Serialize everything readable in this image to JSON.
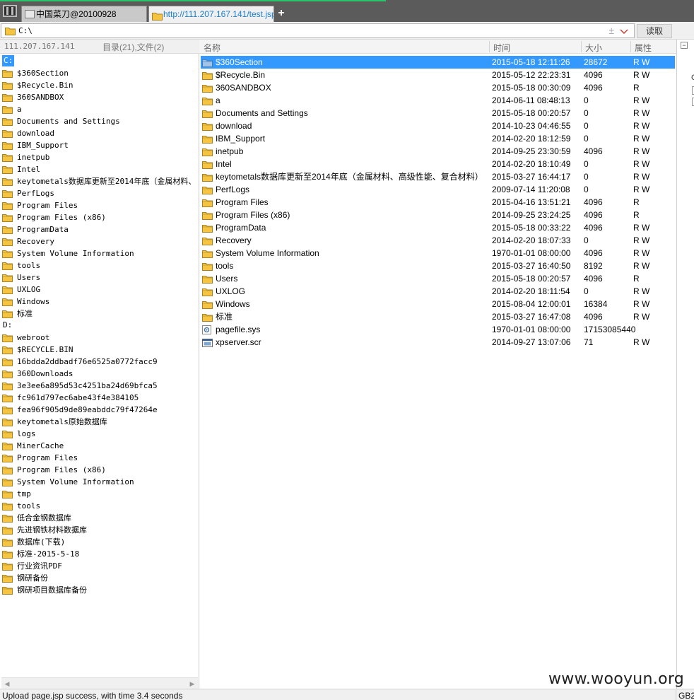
{
  "tabs": [
    {
      "label": "中国菜刀@20100928",
      "active": false
    },
    {
      "label": "http://111.207.167.141/test.jsp",
      "active": true
    }
  ],
  "address": {
    "value": "C:\\",
    "read_button": "读取",
    "plus": "±"
  },
  "left_header": {
    "host": "111.207.167.141",
    "counts": "目录(21),文件(2)"
  },
  "columns": {
    "name": "名称",
    "time": "时间",
    "size": "大小",
    "attr": "属性"
  },
  "tree_c": {
    "drive": "C:",
    "items": [
      "$360Section",
      "$Recycle.Bin",
      "360SANDBOX",
      "a",
      "Documents and Settings",
      "download",
      "IBM_Support",
      "inetpub",
      "Intel",
      "keytometals数据库更新至2014年底（金属材料、",
      "PerfLogs",
      "Program Files",
      "Program Files (x86)",
      "ProgramData",
      "Recovery",
      "System Volume Information",
      "tools",
      "Users",
      "UXLOG",
      "Windows",
      "标准"
    ]
  },
  "tree_d": {
    "drive": "D:",
    "items": [
      "webroot",
      "$RECYCLE.BIN",
      "16bdda2ddbadf76e6525a0772facc9",
      "360Downloads",
      "3e3ee6a895d53c4251ba24d69bfca5",
      "fc961d797ec6abe43f4e384105",
      "fea96f905d9de89eabddc79f47264e",
      "keytometals原始数据库",
      "logs",
      "MinerCache",
      "Program Files",
      "Program Files (x86)",
      "System Volume Information",
      "tmp",
      "tools",
      "低合金钢数据库",
      "先进钢铁材料数据库",
      "数据库(下载)",
      "标准-2015-5-18",
      "行业资讯PDF",
      "钢研备份",
      "钢研项目数据库备份"
    ]
  },
  "files": [
    {
      "name": "$360Section",
      "time": "2015-05-18 12:11:26",
      "size": "28672",
      "attr": "R W",
      "type": "folder-open",
      "selected": true
    },
    {
      "name": "$Recycle.Bin",
      "time": "2015-05-12 22:23:31",
      "size": "4096",
      "attr": "R W",
      "type": "folder"
    },
    {
      "name": "360SANDBOX",
      "time": "2015-05-18 00:30:09",
      "size": "4096",
      "attr": "R",
      "type": "folder"
    },
    {
      "name": "a",
      "time": "2014-06-11 08:48:13",
      "size": "0",
      "attr": "R W",
      "type": "folder"
    },
    {
      "name": "Documents and Settings",
      "time": "2015-05-18 00:20:57",
      "size": "0",
      "attr": "R W",
      "type": "folder"
    },
    {
      "name": "download",
      "time": "2014-10-23 04:46:55",
      "size": "0",
      "attr": "R W",
      "type": "folder"
    },
    {
      "name": "IBM_Support",
      "time": "2014-02-20 18:12:59",
      "size": "0",
      "attr": "R W",
      "type": "folder"
    },
    {
      "name": "inetpub",
      "time": "2014-09-25 23:30:59",
      "size": "4096",
      "attr": "R W",
      "type": "folder"
    },
    {
      "name": "Intel",
      "time": "2014-02-20 18:10:49",
      "size": "0",
      "attr": "R W",
      "type": "folder"
    },
    {
      "name": "keytometals数据库更新至2014年底（金属材料、高级性能、复合材料）",
      "time": "2015-03-27 16:44:17",
      "size": "0",
      "attr": "R W",
      "type": "folder"
    },
    {
      "name": "PerfLogs",
      "time": "2009-07-14 11:20:08",
      "size": "0",
      "attr": "R W",
      "type": "folder"
    },
    {
      "name": "Program Files",
      "time": "2015-04-16 13:51:21",
      "size": "4096",
      "attr": "R",
      "type": "folder"
    },
    {
      "name": "Program Files (x86)",
      "time": "2014-09-25 23:24:25",
      "size": "4096",
      "attr": "R",
      "type": "folder"
    },
    {
      "name": "ProgramData",
      "time": "2015-05-18 00:33:22",
      "size": "4096",
      "attr": "R W",
      "type": "folder"
    },
    {
      "name": "Recovery",
      "time": "2014-02-20 18:07:33",
      "size": "0",
      "attr": "R W",
      "type": "folder"
    },
    {
      "name": "System Volume Information",
      "time": "1970-01-01 08:00:00",
      "size": "4096",
      "attr": "R W",
      "type": "folder"
    },
    {
      "name": "tools",
      "time": "2015-03-27 16:40:50",
      "size": "8192",
      "attr": "R W",
      "type": "folder"
    },
    {
      "name": "Users",
      "time": "2015-05-18 00:20:57",
      "size": "4096",
      "attr": "R",
      "type": "folder"
    },
    {
      "name": "UXLOG",
      "time": "2014-02-20 18:11:54",
      "size": "0",
      "attr": "R W",
      "type": "folder"
    },
    {
      "name": "Windows",
      "time": "2015-08-04 12:00:01",
      "size": "16384",
      "attr": "R W",
      "type": "folder"
    },
    {
      "name": "标准",
      "time": "2015-03-27 16:47:08",
      "size": "4096",
      "attr": "R W",
      "type": "folder"
    },
    {
      "name": "pagefile.sys",
      "time": "1970-01-01 08:00:00",
      "size": "17153085440",
      "attr": "",
      "type": "sys-file"
    },
    {
      "name": "xpserver.scr",
      "time": "2014-09-27 13:07:06",
      "size": "71",
      "attr": "R W",
      "type": "scr-file"
    }
  ],
  "sliver": {
    "minus": "−",
    "letter": "G"
  },
  "status": {
    "text": "Upload page.jsp success, with time 3.4 seconds",
    "encoding": "GB2"
  },
  "watermark": "www.wooyun.org",
  "colors": {
    "selection": "#3399ff",
    "folder": "#f5c542",
    "tabbar": "#5b5b5b",
    "active_tab_text": "#1a7fd0"
  }
}
